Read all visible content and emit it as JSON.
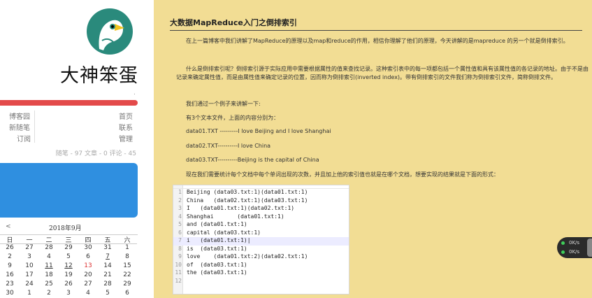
{
  "sidebar": {
    "site_name": "大神笨蛋",
    "site_dot": ".",
    "links_left": [
      "博客园",
      "新随笔",
      "订阅"
    ],
    "links_right": [
      "首页",
      "联系",
      "管理"
    ],
    "stats": "随笔 - 97  文章 - 0  评论 - 45"
  },
  "calendar": {
    "prev": "<",
    "title": "2018年9月",
    "weekdays": [
      "日",
      "一",
      "二",
      "三",
      "四",
      "五",
      "六"
    ],
    "weeks": [
      [
        "26",
        "27",
        "28",
        "29",
        "30",
        "31",
        "1"
      ],
      [
        "2",
        "3",
        "4",
        "5",
        "6",
        "7",
        "8"
      ],
      [
        "9",
        "10",
        "11",
        "12",
        "13",
        "14",
        "15"
      ],
      [
        "16",
        "17",
        "18",
        "19",
        "20",
        "21",
        "22"
      ],
      [
        "23",
        "24",
        "25",
        "26",
        "27",
        "28",
        "29"
      ],
      [
        "30",
        "1",
        "2",
        "3",
        "4",
        "5",
        "6"
      ]
    ]
  },
  "article": {
    "title": "大数据MapReduce入门之倒排索引",
    "p1": "在上一篇博客中我们讲解了MapReduce的原理以及map和reduce的作用，相信你理解了他们的原理，今天讲解的是mapreduce 的另一个就是倒排索引。",
    "p2": "什么是倒排索引呢？倒排索引源于实际应用中需要根据属性的值来查找记录。这种索引表中的每一项都包括一个属性值和具有该属性值的各记录的地址。由于不是由记录来确定属性值，而是由属性值来确定记录的位置，因而称为倒排索引(inverted index)。带有倒排索引的文件我们称为倒排索引文件，简称倒排文件。",
    "p3": "我们通过一个例子来讲解一下:",
    "p4": "有3个文本文件，上面的内容分别为：",
    "p5": "data01.TXT ---------I love Beijing and I love Shanghai",
    "p6": "data02.TXT----------I love China",
    "p7": "data03.TXT----------Beijing is the capital of China",
    "p8": "现在我们需要统计每个文档中每个单词出现的次数，并且加上他的索引值也就是在哪个文档，想要实现的结果就是下面的形式："
  },
  "code": {
    "line_numbers": [
      "1",
      "2",
      "3",
      "4",
      "5",
      "6",
      "7",
      "8",
      "9",
      "10",
      "11",
      "12"
    ],
    "lines": [
      "Beijing (data03.txt:1)(data01.txt:1)",
      "China   (data02.txt:1)(data03.txt:1)",
      "I   (data01.txt:1)(data02.txt:1)",
      "Shanghai       (data01.txt:1)",
      "and (data01.txt:1)",
      "capital (data03.txt:1)",
      "i   (data01.txt:1)|",
      "is  (data03.txt:1)",
      "love    (data01.txt:2)(data02.txt:1)",
      "of  (data03.txt:1)",
      "the (data03.txt:1)",
      ""
    ]
  },
  "net_widget": {
    "up": "0K/s",
    "down": "0K/s"
  },
  "colors": {
    "background": "#f2dd94",
    "logo": "#2a8a7c",
    "accent_red": "#e34a4a",
    "accent_blue": "#2f8fe0"
  }
}
